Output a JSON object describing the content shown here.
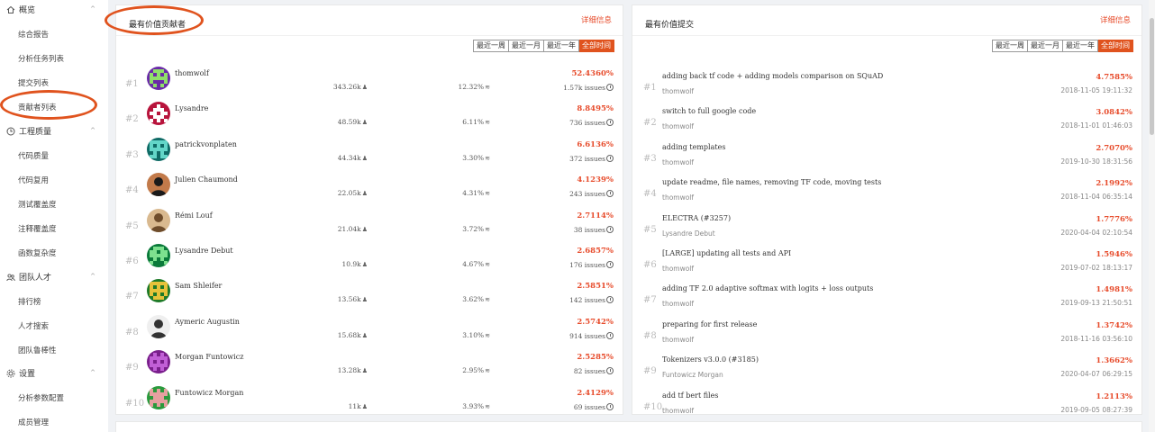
{
  "sidebar": {
    "groups": [
      {
        "label": "概览",
        "icon": "home-icon",
        "items": [
          "综合报告",
          "分析任务列表",
          "提交列表",
          "贡献者列表"
        ]
      },
      {
        "label": "工程质量",
        "icon": "clock-icon",
        "items": [
          "代码质量",
          "代码复用",
          "测试覆盖度",
          "注释覆盖度",
          "函数复杂度"
        ]
      },
      {
        "label": "团队人才",
        "icon": "team-icon",
        "items": [
          "排行榜",
          "人才搜索",
          "团队鲁棒性"
        ]
      },
      {
        "label": "设置",
        "icon": "gear-icon",
        "items": [
          "分析参数配置",
          "成员管理"
        ]
      }
    ]
  },
  "contributors": {
    "title": "最有价值贡献者",
    "more": "详细信息",
    "filters": [
      "最近一周",
      "最近一月",
      "最近一年",
      "全部时间"
    ],
    "active_filter": "全部时间",
    "rows": [
      {
        "rank": "#1",
        "name": "thomwolf",
        "loc": "343.26k",
        "ratio": "12.32%",
        "issues": "1.57k issues",
        "pct": "52.4360%"
      },
      {
        "rank": "#2",
        "name": "Lysandre",
        "loc": "48.59k",
        "ratio": "6.11%",
        "issues": "736 issues",
        "pct": "8.8495%"
      },
      {
        "rank": "#3",
        "name": "patrickvonplaten",
        "loc": "44.34k",
        "ratio": "3.30%",
        "issues": "372 issues",
        "pct": "6.6136%"
      },
      {
        "rank": "#4",
        "name": "Julien Chaumond",
        "loc": "22.05k",
        "ratio": "4.31%",
        "issues": "243 issues",
        "pct": "4.1239%"
      },
      {
        "rank": "#5",
        "name": "Rémi Louf",
        "loc": "21.04k",
        "ratio": "3.72%",
        "issues": "38 issues",
        "pct": "2.7114%"
      },
      {
        "rank": "#6",
        "name": "Lysandre Debut",
        "loc": "10.9k",
        "ratio": "4.67%",
        "issues": "176 issues",
        "pct": "2.6857%"
      },
      {
        "rank": "#7",
        "name": "Sam Shleifer",
        "loc": "13.56k",
        "ratio": "3.62%",
        "issues": "142 issues",
        "pct": "2.5851%"
      },
      {
        "rank": "#8",
        "name": "Aymeric Augustin",
        "loc": "15.68k",
        "ratio": "3.10%",
        "issues": "914 issues",
        "pct": "2.5742%"
      },
      {
        "rank": "#9",
        "name": "Morgan Funtowicz",
        "loc": "13.28k",
        "ratio": "2.95%",
        "issues": "82 issues",
        "pct": "2.5285%"
      },
      {
        "rank": "#10",
        "name": "Funtowicz Morgan",
        "loc": "11k",
        "ratio": "3.93%",
        "issues": "69 issues",
        "pct": "2.4129%"
      }
    ]
  },
  "commits": {
    "title": "最有价值提交",
    "more": "详细信息",
    "filters": [
      "最近一周",
      "最近一月",
      "最近一年",
      "全部时间"
    ],
    "active_filter": "全部时间",
    "rows": [
      {
        "rank": "#1",
        "message": "adding back tf code + adding models comparison on SQuAD",
        "author": "thomwolf",
        "pct": "4.7585%",
        "date": "2018-11-05 19:11:32"
      },
      {
        "rank": "#2",
        "message": "switch to full google code",
        "author": "thomwolf",
        "pct": "3.0842%",
        "date": "2018-11-01 01:46:03"
      },
      {
        "rank": "#3",
        "message": "adding templates",
        "author": "thomwolf",
        "pct": "2.7070%",
        "date": "2019-10-30 18:31:56"
      },
      {
        "rank": "#4",
        "message": "update readme, file names, removing TF code, moving tests",
        "author": "thomwolf",
        "pct": "2.1992%",
        "date": "2018-11-04 06:35:14"
      },
      {
        "rank": "#5",
        "message": "ELECTRA (#3257)",
        "author": "Lysandre Debut",
        "pct": "1.7776%",
        "date": "2020-04-04 02:10:54"
      },
      {
        "rank": "#6",
        "message": "[LARGE] updating all tests and API",
        "author": "thomwolf",
        "pct": "1.5946%",
        "date": "2019-07-02 18:13:17"
      },
      {
        "rank": "#7",
        "message": "adding TF 2.0 adaptive softmax with logits + loss outputs",
        "author": "thomwolf",
        "pct": "1.4981%",
        "date": "2019-09-13 21:50:51"
      },
      {
        "rank": "#8",
        "message": "preparing for first release",
        "author": "thomwolf",
        "pct": "1.3742%",
        "date": "2018-11-16 03:56:10"
      },
      {
        "rank": "#9",
        "message": "Tokenizers v3.0.0 (#3185)",
        "author": "Funtowicz Morgan",
        "pct": "1.3662%",
        "date": "2020-04-07 06:29:15"
      },
      {
        "rank": "#10",
        "message": "add tf bert files",
        "author": "thomwolf",
        "pct": "1.2113%",
        "date": "2019-09-05 08:27:39"
      }
    ]
  },
  "colors": {
    "accent": "#e74c2c",
    "annotation": "#e0531e"
  }
}
